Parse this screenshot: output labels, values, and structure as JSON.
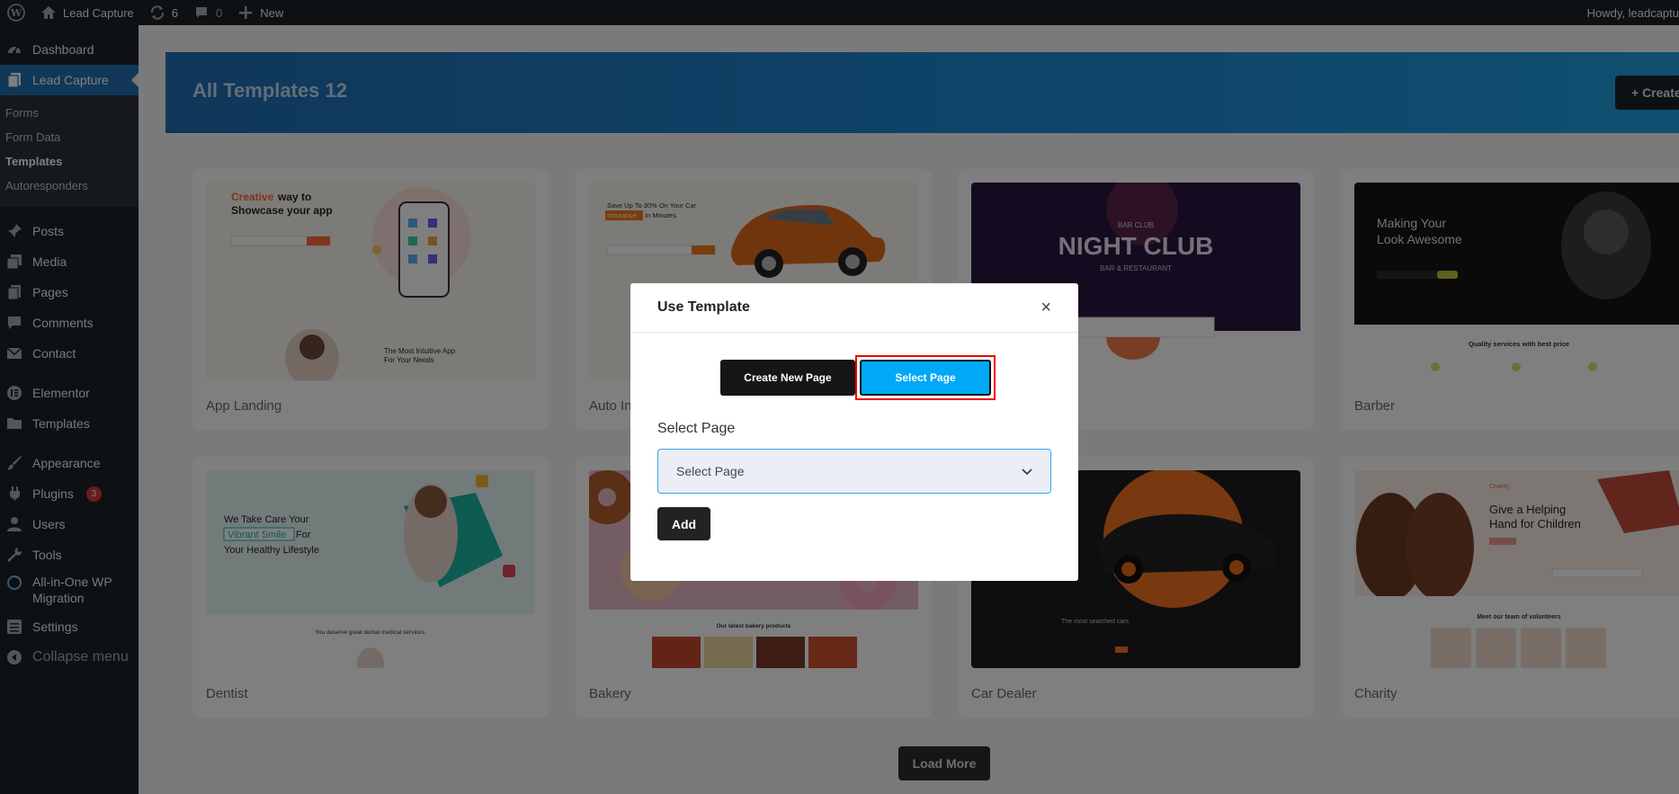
{
  "adminbar": {
    "site_name": "Lead Capture",
    "updates_count": "6",
    "comments_count": "0",
    "new_label": "New",
    "howdy": "Howdy, leadcaptu"
  },
  "sidebar": {
    "items": [
      {
        "label": "Dashboard",
        "icon": "dashboard-icon"
      },
      {
        "label": "Lead Capture",
        "icon": "pages-icon",
        "current": true
      },
      {
        "label": "Posts",
        "icon": "pin-icon"
      },
      {
        "label": "Media",
        "icon": "media-icon"
      },
      {
        "label": "Pages",
        "icon": "page-icon"
      },
      {
        "label": "Comments",
        "icon": "comment-icon"
      },
      {
        "label": "Contact",
        "icon": "mail-icon"
      },
      {
        "label": "Elementor",
        "icon": "elementor-icon"
      },
      {
        "label": "Templates",
        "icon": "folder-icon"
      },
      {
        "label": "Appearance",
        "icon": "brush-icon"
      },
      {
        "label": "Plugins",
        "icon": "plug-icon",
        "badge": "3"
      },
      {
        "label": "Users",
        "icon": "user-icon"
      },
      {
        "label": "Tools",
        "icon": "wrench-icon"
      },
      {
        "label": "All-in-One WP Migration",
        "icon": "migration-icon"
      },
      {
        "label": "Settings",
        "icon": "settings-icon"
      },
      {
        "label": "Collapse menu",
        "icon": "collapse-icon"
      }
    ],
    "submenu": [
      "Forms",
      "Form Data",
      "Templates",
      "Autoresponders"
    ]
  },
  "header": {
    "title": "All Templates 12",
    "create_label": "+ Create New"
  },
  "cards": [
    {
      "title": "App Landing"
    },
    {
      "title": "Auto In"
    },
    {
      "title": ""
    },
    {
      "title": "Barber"
    },
    {
      "title": "Dentist"
    },
    {
      "title": "Bakery"
    },
    {
      "title": "Car Dealer"
    },
    {
      "title": "Charity"
    }
  ],
  "thumb_text": {
    "app": {
      "line1a": "Creative",
      "line1b": " way to",
      "line2": "Showcase your app",
      "bottom1": "The Most Intuitive App",
      "bottom2": "For Your Needs"
    },
    "auto": {
      "line1": "Save Up To 30% On Your Car",
      "line2a": "Insurance",
      "line2b": " In Minutes."
    },
    "club": {
      "small": "BAR CLUB",
      "big": "NIGHT CLUB",
      "sub": "BAR & RESTAURANT"
    },
    "barber": {
      "l1": "Making Your",
      "l2": "Look Awesome",
      "q": "Quality services with best price"
    },
    "dentist": {
      "l1": "We Take Care Your",
      "l2a": "Vibrant Smile",
      "l2b": " For",
      "l3": "Your Healthy Lifestyle",
      "bottom": "You deserve great dental medical services."
    },
    "bakery": {
      "products": "Our latest bakery products"
    },
    "car": {
      "searched": "The most searched cars"
    },
    "charity": {
      "l1": "Give a Helping",
      "l2": "Hand for Children",
      "team": "Meet our team of volunteers",
      "brand": "Charity"
    }
  },
  "load_more": "Load More",
  "modal": {
    "title": "Use Template",
    "close": "×",
    "btn_create": "Create New Page",
    "btn_select": "Select Page",
    "field_label": "Select Page",
    "select_value": "Select Page",
    "add_label": "Add"
  }
}
